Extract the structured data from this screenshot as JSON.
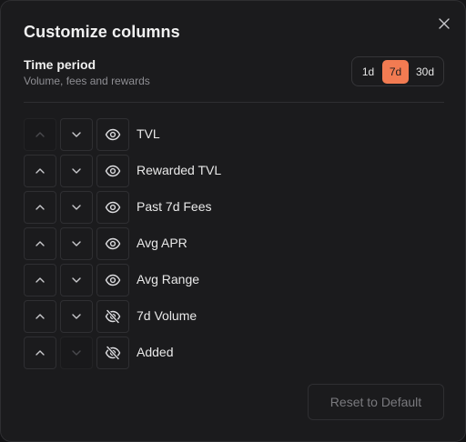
{
  "modal": {
    "title": "Customize columns",
    "close_icon": "close-icon"
  },
  "time_period": {
    "label": "Time period",
    "subtitle": "Volume, fees and rewards",
    "options": [
      "1d",
      "7d",
      "30d"
    ],
    "selected": "7d",
    "accent_color": "#f27b52"
  },
  "columns": [
    {
      "label": "TVL",
      "visible": true,
      "can_move_up": false,
      "can_move_down": true
    },
    {
      "label": "Rewarded TVL",
      "visible": true,
      "can_move_up": true,
      "can_move_down": true
    },
    {
      "label": "Past 7d Fees",
      "visible": true,
      "can_move_up": true,
      "can_move_down": true
    },
    {
      "label": "Avg APR",
      "visible": true,
      "can_move_up": true,
      "can_move_down": true
    },
    {
      "label": "Avg Range",
      "visible": true,
      "can_move_up": true,
      "can_move_down": true
    },
    {
      "label": "7d Volume",
      "visible": false,
      "can_move_up": true,
      "can_move_down": true
    },
    {
      "label": "Added",
      "visible": false,
      "can_move_up": true,
      "can_move_down": false
    }
  ],
  "icons": {
    "up": "chevron-up-icon",
    "down": "chevron-down-icon",
    "visible": "eye-icon",
    "hidden": "eye-off-icon"
  },
  "footer": {
    "reset_label": "Reset to Default",
    "reset_enabled": false
  }
}
